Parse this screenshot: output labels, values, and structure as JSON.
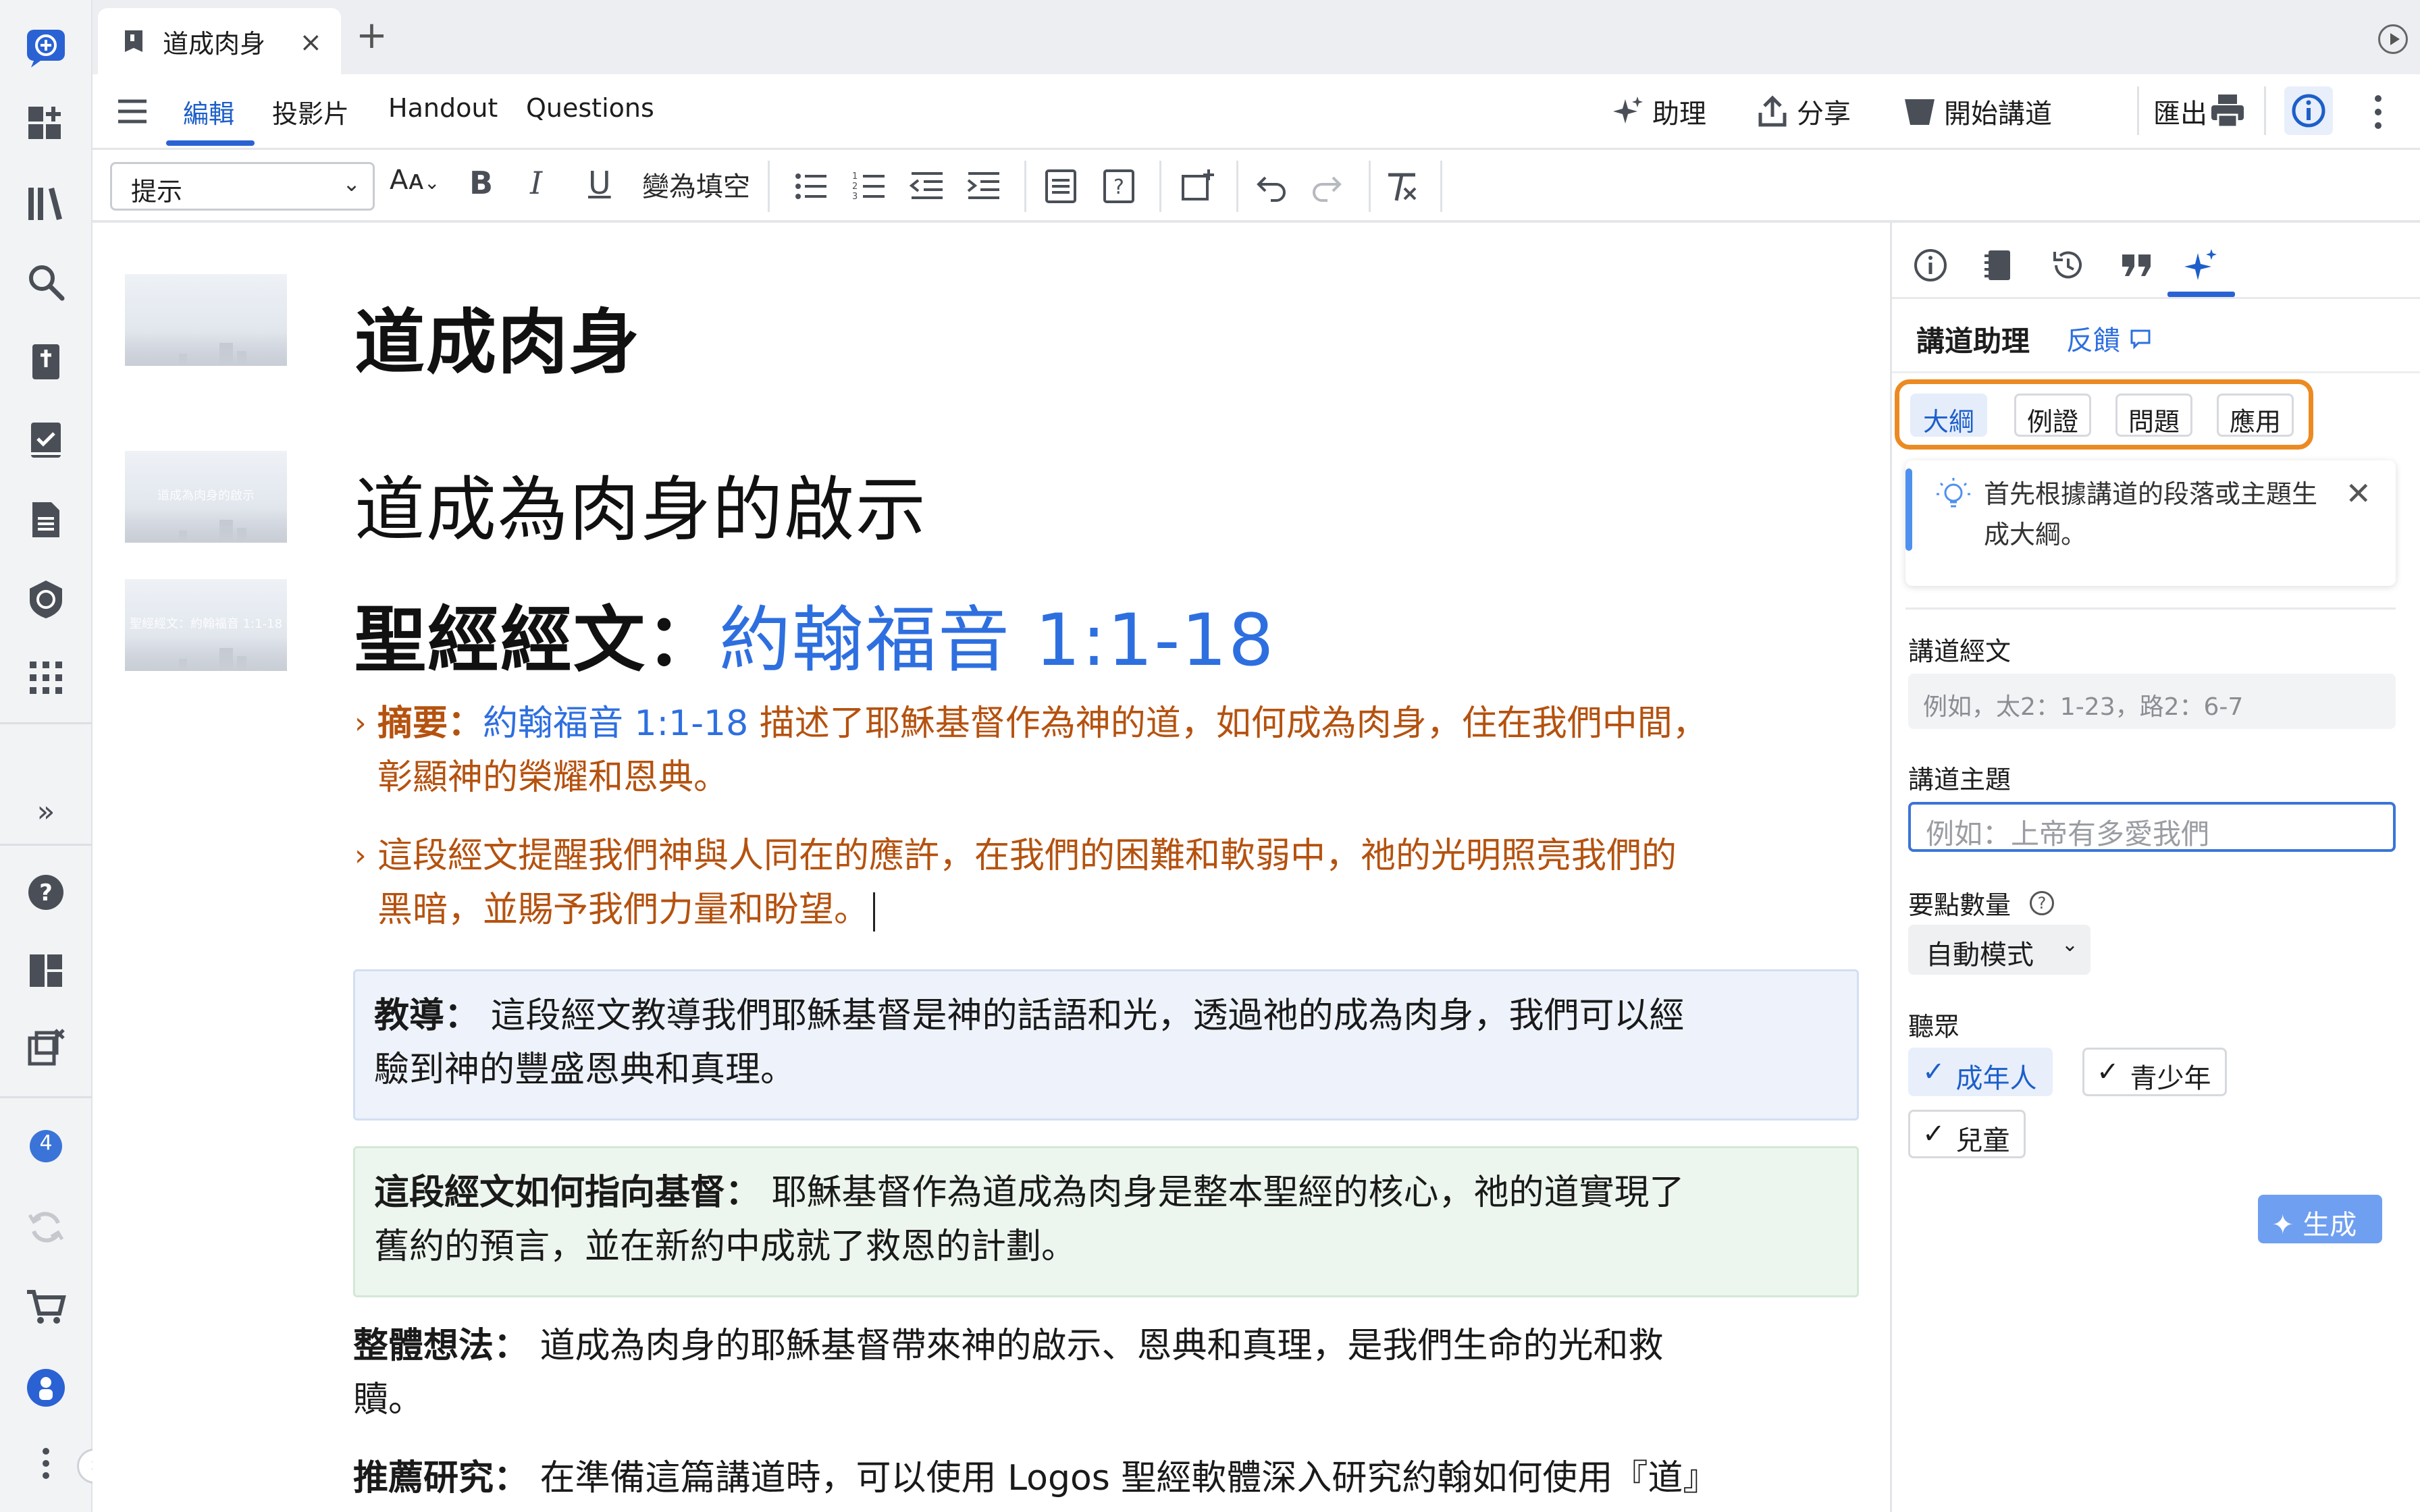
{
  "tabstrip": {
    "doc_tab_title": "道成肉身",
    "close_glyph": "×",
    "new_tab_glyph": "+"
  },
  "menubar": {
    "tabs": [
      "編輯",
      "投影片",
      "Handout",
      "Questions"
    ],
    "assistant": "助理",
    "share": "分享",
    "start_preaching": "開始講道",
    "export": "匯出"
  },
  "toolbar": {
    "style_select_value": "提示",
    "font_size_glyph": "Aᴀ",
    "bold": "B",
    "italic": "I",
    "underline": "U",
    "fill_blank": "變為填空"
  },
  "document": {
    "title": "道成肉身",
    "heading": "道成為肉身的啟示",
    "scripture_label": "聖經經文：",
    "scripture_ref": "約翰福音 1:1-18",
    "slide_thumbs": [
      {
        "label": ""
      },
      {
        "label": "道成為肉身的啟示"
      },
      {
        "label": "聖經經文：約翰福音 1:1-18"
      }
    ],
    "bullets": [
      {
        "lead": "摘要：",
        "ref": "約翰福音 1:1-18",
        "line1": " 描述了耶穌基督作為神的道，如何成為肉身，住在我們中間，",
        "line2": "彰顯神的榮耀和恩典。"
      },
      {
        "line1": "這段經文提醒我們神與人同在的應許，在我們的困難和軟弱中，祂的光明照亮我們的",
        "line2": "黑暗，並賜予我們力量和盼望。"
      }
    ],
    "callout_teach": {
      "lead": "教導：",
      "line1": " 這段經文教導我們耶穌基督是神的話語和光，透過祂的成為肉身，我們可以經",
      "line2": "驗到神的豐盛恩典和真理。"
    },
    "callout_christ": {
      "lead": "這段經文如何指向基督：",
      "line1": " 耶穌基督作為道成為肉身是整本聖經的核心，祂的道實現了",
      "line2": "舊約的預言，並在新約中成就了救恩的計劃。"
    },
    "overall": {
      "lead": "整體想法：",
      "line1": " 道成為肉身的耶穌基督帶來神的啟示、恩典和真理，是我們生命的光和救",
      "line2": "贖。"
    },
    "study": {
      "lead": "推薦研究：",
      "line1": " 在準備這篇講道時，可以使用 Logos 聖經軟體深入研究約翰如何使用『道』"
    }
  },
  "panel": {
    "title": "講道助理",
    "feedback": "反饋",
    "chips": [
      "大綱",
      "例證",
      "問題",
      "應用"
    ],
    "active_chip": "大綱",
    "tip": "首先根據講道的段落或主題生成大綱。",
    "tip_close": "✕",
    "scripture_label": "講道經文",
    "scripture_placeholder": "例如，太2：1-23，路2：6-7",
    "topic_label": "講道主題",
    "topic_placeholder": "例如：上帝有多愛我們",
    "points_label": "要點數量",
    "help_glyph": "?",
    "mode_value": "自動模式",
    "audience_label": "聽眾",
    "audience": [
      {
        "label": "成年人",
        "selected": true
      },
      {
        "label": "青少年",
        "selected": false
      },
      {
        "label": "兒童",
        "selected": false
      }
    ],
    "generate": "生成"
  },
  "rail": {
    "expand_glyph": "»",
    "badge_count": "4",
    "collapse_glyph": "›"
  },
  "colors": {
    "accent_blue": "#2a62d4",
    "link_blue": "#2e6fe0",
    "bullet_orange": "#b5520f",
    "chip_highlight_orange": "#ec8a22",
    "teach_bg": "#eef3fb",
    "christ_bg": "#edf6ee"
  }
}
